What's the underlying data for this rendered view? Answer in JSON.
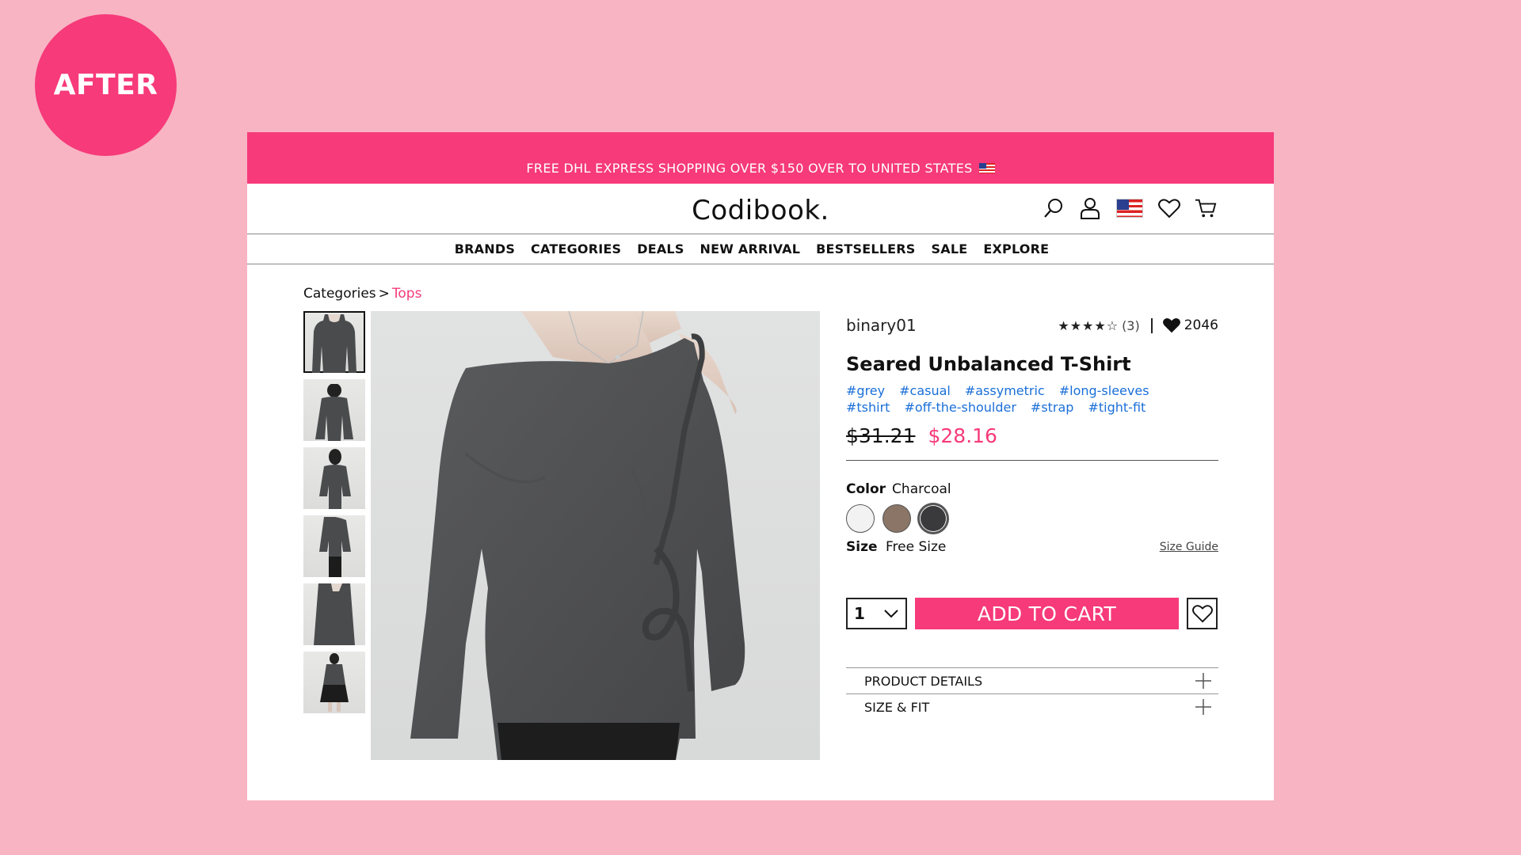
{
  "badge": {
    "label": "AFTER"
  },
  "promo": {
    "text": "FREE DHL EXPRESS SHOPPING OVER $150 OVER TO UNITED STATES"
  },
  "header": {
    "logo": "Codibook."
  },
  "nav": {
    "items": [
      "BRANDS",
      "CATEGORIES",
      "DEALS",
      "NEW ARRIVAL",
      "BESTSELLERS",
      "SALE",
      "EXPLORE"
    ]
  },
  "breadcrumb": {
    "root": "Categories",
    "separator": ">",
    "current": "Tops"
  },
  "product": {
    "seller": "binary01",
    "rating_stars": "★★★★☆",
    "rating_count": "(3)",
    "rating_value": 4,
    "likes": "2046",
    "title": "Seared Unbalanced T-Shirt",
    "tags": [
      "#grey",
      "#casual",
      "#assymetric",
      "#long-sleeves",
      "#tshirt",
      "#off-the-shoulder",
      "#strap",
      "#tight-fit"
    ],
    "old_price": "$31.21",
    "new_price": "$28.16",
    "color_label": "Color",
    "color_value": "Charcoal",
    "swatches": [
      "#f2f2f2",
      "#8a7566",
      "#3a3a3c"
    ],
    "selected_swatch": 2,
    "size_label": "Size",
    "size_value": "Free Size",
    "size_guide": "Size Guide",
    "quantity": "1",
    "add_to_cart": "ADD TO CART",
    "accordion": [
      "PRODUCT DETAILS",
      "SIZE & FIT"
    ]
  },
  "colors": {
    "accent": "#f63a7a",
    "background": "#f8b4c3",
    "tag": "#1a6fd8"
  },
  "icons": [
    "search-icon",
    "user-icon",
    "us-flag-icon",
    "heart-icon",
    "cart-icon",
    "chevron-down-icon",
    "plus-icon"
  ]
}
